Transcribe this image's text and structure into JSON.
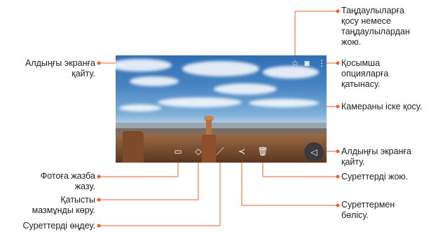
{
  "callouts": {
    "favorite": [
      "Таңдаулыларға",
      "қосу немесе",
      "таңдаулылардан",
      "жою."
    ],
    "more_options": [
      "Қосымша",
      "опцияларға",
      "қатынасу."
    ],
    "camera": [
      "Камераны іске қосу."
    ],
    "back_top": [
      "Алдыңғы экранға",
      "қайту."
    ],
    "back_bottom": [
      "Алдыңғы экранға",
      "қайту."
    ],
    "delete": [
      "Суреттерді жою."
    ],
    "share": [
      "Суреттермен",
      "бөлісу."
    ],
    "memo": [
      "Фотоға жазба",
      "жазу."
    ],
    "related": [
      "Қатысты",
      "мазмұнды көру."
    ],
    "edit": [
      "Суреттерді өңдеу."
    ]
  },
  "colors": {
    "leader": "#e8612c"
  },
  "icons": {
    "back_top": "arrow-left-icon",
    "favorite": "star-icon",
    "camera": "camera-icon",
    "more": "more-vertical-icon",
    "memo": "memo-icon",
    "related": "tag-icon",
    "edit": "pencil-icon",
    "share": "share-icon",
    "delete": "trash-icon",
    "back_bottom": "back-triangle-icon"
  }
}
